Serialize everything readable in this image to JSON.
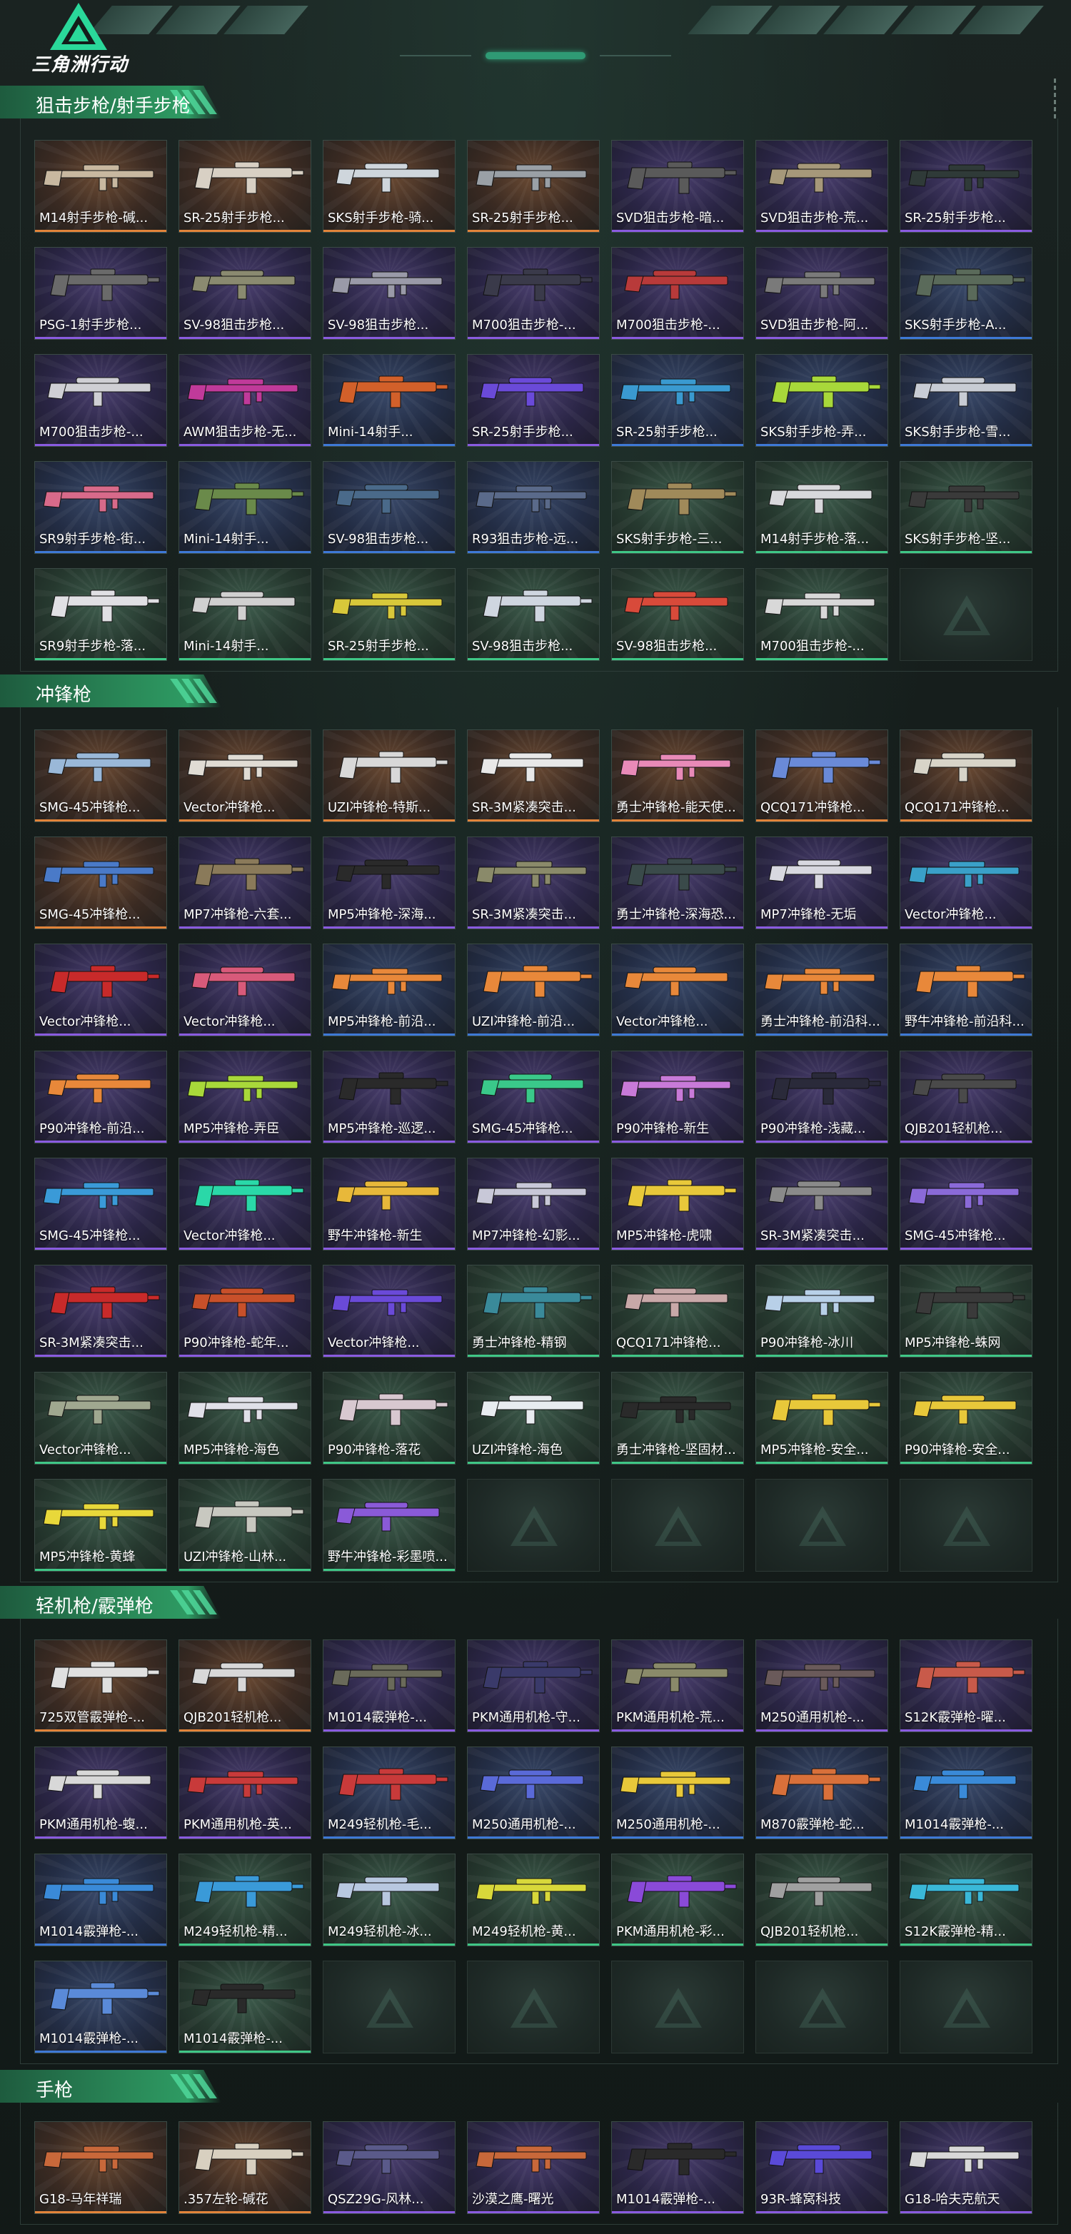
{
  "header": {
    "logo_text": "三角洲行动"
  },
  "colors": {
    "orange": "#e2843a",
    "purple": "#8a5be0",
    "blue": "#3e79d6",
    "green": "#3fc786",
    "section_green": "#2a8a59"
  },
  "sections": [
    {
      "title": "狙击步枪/射手步枪",
      "items": [
        {
          "name": "M14射手步枪-碱...",
          "rarity": "orange",
          "tint": "#c8b8a0"
        },
        {
          "name": "SR-25射手步枪...",
          "rarity": "orange",
          "tint": "#d8d0c4"
        },
        {
          "name": "SKS射手步枪-骑...",
          "rarity": "orange",
          "tint": "#cfd6dc"
        },
        {
          "name": "SR-25射手步枪...",
          "rarity": "orange",
          "tint": "#9aa0a6"
        },
        {
          "name": "SVD狙击步枪-暗...",
          "rarity": "purple",
          "tint": "#5a5a5a"
        },
        {
          "name": "SVD狙击步枪-荒...",
          "rarity": "purple",
          "tint": "#a6987a"
        },
        {
          "name": "SR-25射手步枪...",
          "rarity": "purple",
          "tint": "#2f3a38"
        },
        {
          "name": "PSG-1射手步枪...",
          "rarity": "purple",
          "tint": "#6a6a6a"
        },
        {
          "name": "SV-98狙击步枪...",
          "rarity": "purple",
          "tint": "#8a8a70"
        },
        {
          "name": "SV-98狙击步枪...",
          "rarity": "purple",
          "tint": "#9a9aa8"
        },
        {
          "name": "M700狙击步枪-...",
          "rarity": "purple",
          "tint": "#3a3a4a"
        },
        {
          "name": "M700狙击步枪-...",
          "rarity": "purple",
          "tint": "#b83a3a"
        },
        {
          "name": "SVD狙击步枪-阿...",
          "rarity": "purple",
          "tint": "#7a7a7a"
        },
        {
          "name": "SKS射手步枪-A...",
          "rarity": "blue",
          "tint": "#5a6a5a"
        },
        {
          "name": "M700狙击步枪-...",
          "rarity": "purple",
          "tint": "#cfcfd4"
        },
        {
          "name": "AWM狙击步枪-无...",
          "rarity": "purple",
          "tint": "#c03a9a"
        },
        {
          "name": "Mini-14射手...",
          "rarity": "blue",
          "tint": "#d2602a"
        },
        {
          "name": "SR-25射手步枪...",
          "rarity": "purple",
          "tint": "#6a4ad8"
        },
        {
          "name": "SR-25射手步枪...",
          "rarity": "blue",
          "tint": "#3a9ad0"
        },
        {
          "name": "SKS射手步枪-弄...",
          "rarity": "blue",
          "tint": "#a8d83a"
        },
        {
          "name": "SKS射手步枪-雪...",
          "rarity": "blue",
          "tint": "#c8ccd4"
        },
        {
          "name": "SR9射手步枪-街...",
          "rarity": "blue",
          "tint": "#d86a8a"
        },
        {
          "name": "Mini-14射手...",
          "rarity": "blue",
          "tint": "#6a8a4a"
        },
        {
          "name": "SV-98狙击步枪...",
          "rarity": "blue",
          "tint": "#4a6a8a"
        },
        {
          "name": "R93狙击步枪-远...",
          "rarity": "blue",
          "tint": "#5a6a8a"
        },
        {
          "name": "SKS射手步枪-三...",
          "rarity": "green",
          "tint": "#a08a5a"
        },
        {
          "name": "M14射手步枪-落...",
          "rarity": "green",
          "tint": "#d8d8dc"
        },
        {
          "name": "SKS射手步枪-坚...",
          "rarity": "green",
          "tint": "#3a3a3a"
        },
        {
          "name": "SR9射手步枪-落...",
          "rarity": "green",
          "tint": "#e0e0e4"
        },
        {
          "name": "Mini-14射手...",
          "rarity": "green",
          "tint": "#d0d0d0"
        },
        {
          "name": "SR-25射手步枪...",
          "rarity": "green",
          "tint": "#d8c83a"
        },
        {
          "name": "SV-98狙击步枪...",
          "rarity": "green",
          "tint": "#cfd6e0"
        },
        {
          "name": "SV-98狙击步枪...",
          "rarity": "green",
          "tint": "#d84a3a"
        },
        {
          "name": "M700狙击步枪-...",
          "rarity": "green",
          "tint": "#d8d8d8"
        },
        {
          "name": "",
          "rarity": "empty",
          "tint": ""
        }
      ]
    },
    {
      "title": "冲锋枪",
      "items": [
        {
          "name": "SMG-45冲锋枪...",
          "rarity": "orange",
          "tint": "#9ab8d8"
        },
        {
          "name": "Vector冲锋枪...",
          "rarity": "orange",
          "tint": "#e0dcd4"
        },
        {
          "name": "UZI冲锋枪-特斯...",
          "rarity": "orange",
          "tint": "#d8d8d8"
        },
        {
          "name": "SR-3M紧凑突击...",
          "rarity": "orange",
          "tint": "#e8e8e8"
        },
        {
          "name": "勇士冲锋枪-能天使...",
          "rarity": "orange",
          "tint": "#e88ab8"
        },
        {
          "name": "QCQ171冲锋枪...",
          "rarity": "orange",
          "tint": "#6a8ad8"
        },
        {
          "name": "QCQ171冲锋枪...",
          "rarity": "orange",
          "tint": "#d8d4c8"
        },
        {
          "name": "SMG-45冲锋枪...",
          "rarity": "orange",
          "tint": "#4a7ac8"
        },
        {
          "name": "MP7冲锋枪-六套...",
          "rarity": "purple",
          "tint": "#8a7a5a"
        },
        {
          "name": "MP5冲锋枪-深海...",
          "rarity": "purple",
          "tint": "#2a2a2a"
        },
        {
          "name": "SR-3M紧凑突击...",
          "rarity": "purple",
          "tint": "#8a8a6a"
        },
        {
          "name": "勇士冲锋枪-深海恐...",
          "rarity": "purple",
          "tint": "#3a4a4a"
        },
        {
          "name": "MP7冲锋枪-无垢",
          "rarity": "purple",
          "tint": "#d8d8e0"
        },
        {
          "name": "Vector冲锋枪...",
          "rarity": "purple",
          "tint": "#3aa0c8"
        },
        {
          "name": "Vector冲锋枪...",
          "rarity": "purple",
          "tint": "#c82a2a"
        },
        {
          "name": "Vector冲锋枪...",
          "rarity": "purple",
          "tint": "#d85a7a"
        },
        {
          "name": "MP5冲锋枪-前沿...",
          "rarity": "blue",
          "tint": "#e8883a"
        },
        {
          "name": "UZI冲锋枪-前沿...",
          "rarity": "blue",
          "tint": "#e8883a"
        },
        {
          "name": "Vector冲锋枪...",
          "rarity": "blue",
          "tint": "#e8883a"
        },
        {
          "name": "勇士冲锋枪-前沿科...",
          "rarity": "blue",
          "tint": "#e8883a"
        },
        {
          "name": "野牛冲锋枪-前沿科...",
          "rarity": "blue",
          "tint": "#e8883a"
        },
        {
          "name": "P90冲锋枪-前沿...",
          "rarity": "purple",
          "tint": "#e8883a"
        },
        {
          "name": "MP5冲锋枪-弄臣",
          "rarity": "purple",
          "tint": "#a8d83a"
        },
        {
          "name": "MP5冲锋枪-巡逻...",
          "rarity": "purple",
          "tint": "#2a2a2a"
        },
        {
          "name": "SMG-45冲锋枪...",
          "rarity": "purple",
          "tint": "#3ac88a"
        },
        {
          "name": "P90冲锋枪-新生",
          "rarity": "purple",
          "tint": "#c87ad8"
        },
        {
          "name": "P90冲锋枪-浅藏...",
          "rarity": "purple",
          "tint": "#2a2a3a"
        },
        {
          "name": "QJB201轻机枪...",
          "rarity": "purple",
          "tint": "#4a4a4a"
        },
        {
          "name": "SMG-45冲锋枪...",
          "rarity": "purple",
          "tint": "#3a9ad8"
        },
        {
          "name": "Vector冲锋枪...",
          "rarity": "purple",
          "tint": "#2ad8a8"
        },
        {
          "name": "野牛冲锋枪-新生",
          "rarity": "purple",
          "tint": "#e8b83a"
        },
        {
          "name": "MP7冲锋枪-幻影...",
          "rarity": "purple",
          "tint": "#c8c8d8"
        },
        {
          "name": "MP5冲锋枪-虎啸",
          "rarity": "purple",
          "tint": "#e8c83a"
        },
        {
          "name": "SR-3M紧凑突击...",
          "rarity": "purple",
          "tint": "#8a8a8a"
        },
        {
          "name": "SMG-45冲锋枪...",
          "rarity": "purple",
          "tint": "#8a6ad8"
        },
        {
          "name": "SR-3M紧凑突击...",
          "rarity": "purple",
          "tint": "#c82a2a"
        },
        {
          "name": "P90冲锋枪-蛇年...",
          "rarity": "purple",
          "tint": "#c8502a"
        },
        {
          "name": "Vector冲锋枪...",
          "rarity": "purple",
          "tint": "#6a4ad8"
        },
        {
          "name": "勇士冲锋枪-精钢",
          "rarity": "green",
          "tint": "#3a8a9a"
        },
        {
          "name": "QCQ171冲锋枪...",
          "rarity": "green",
          "tint": "#c8a8a8"
        },
        {
          "name": "P90冲锋枪-冰川",
          "rarity": "green",
          "tint": "#b8d0e8"
        },
        {
          "name": "MP5冲锋枪-蛛网",
          "rarity": "green",
          "tint": "#3a3a3a"
        },
        {
          "name": "Vector冲锋枪...",
          "rarity": "green",
          "tint": "#a0a890"
        },
        {
          "name": "MP5冲锋枪-海色",
          "rarity": "green",
          "tint": "#e0e0e8"
        },
        {
          "name": "P90冲锋枪-落花",
          "rarity": "green",
          "tint": "#d8c8d0"
        },
        {
          "name": "UZI冲锋枪-海色",
          "rarity": "green",
          "tint": "#e8ecf0"
        },
        {
          "name": "勇士冲锋枪-坚固材...",
          "rarity": "green",
          "tint": "#2a2a2a"
        },
        {
          "name": "MP5冲锋枪-安全...",
          "rarity": "green",
          "tint": "#e8c83a"
        },
        {
          "name": "P90冲锋枪-安全...",
          "rarity": "green",
          "tint": "#e8c83a"
        },
        {
          "name": "MP5冲锋枪-黄蜂",
          "rarity": "green",
          "tint": "#e8d83a"
        },
        {
          "name": "UZI冲锋枪-山林...",
          "rarity": "green",
          "tint": "#c8c8c0"
        },
        {
          "name": "野牛冲锋枪-彩墨喷...",
          "rarity": "green",
          "tint": "#8a5ad8"
        },
        {
          "name": "",
          "rarity": "empty",
          "tint": ""
        },
        {
          "name": "",
          "rarity": "empty",
          "tint": ""
        },
        {
          "name": "",
          "rarity": "empty",
          "tint": ""
        },
        {
          "name": "",
          "rarity": "empty",
          "tint": ""
        }
      ]
    },
    {
      "title": "轻机枪/霰弹枪",
      "items": [
        {
          "name": "725双管霰弹枪-...",
          "rarity": "orange",
          "tint": "#e0e0e0"
        },
        {
          "name": "QJB201轻机枪...",
          "rarity": "orange",
          "tint": "#d8d8d8"
        },
        {
          "name": "M1014霰弹枪-...",
          "rarity": "purple",
          "tint": "#6a6a5a"
        },
        {
          "name": "PKM通用机枪-守...",
          "rarity": "purple",
          "tint": "#3a3a6a"
        },
        {
          "name": "PKM通用机枪-荒...",
          "rarity": "purple",
          "tint": "#8a8a6a"
        },
        {
          "name": "M250通用机枪-...",
          "rarity": "purple",
          "tint": "#6a5a5a"
        },
        {
          "name": "S12K霰弹枪-曜...",
          "rarity": "purple",
          "tint": "#c85a4a"
        },
        {
          "name": "PKM通用机枪-蝮...",
          "rarity": "purple",
          "tint": "#d8d8d8"
        },
        {
          "name": "PKM通用机枪-英...",
          "rarity": "purple",
          "tint": "#c83a3a"
        },
        {
          "name": "M249轻机枪-毛...",
          "rarity": "blue",
          "tint": "#c83a3a"
        },
        {
          "name": "M250通用机枪-...",
          "rarity": "blue",
          "tint": "#5a6ad8"
        },
        {
          "name": "M250通用机枪-...",
          "rarity": "blue",
          "tint": "#e8c83a"
        },
        {
          "name": "M870霰弹枪-蛇...",
          "rarity": "blue",
          "tint": "#d8703a"
        },
        {
          "name": "M1014霰弹枪-...",
          "rarity": "blue",
          "tint": "#3a8ad8"
        },
        {
          "name": "M1014霰弹枪-...",
          "rarity": "blue",
          "tint": "#3a8ad8"
        },
        {
          "name": "M249轻机枪-精...",
          "rarity": "green",
          "tint": "#3a9ad8"
        },
        {
          "name": "M249轻机枪-冰...",
          "rarity": "green",
          "tint": "#b8c8e0"
        },
        {
          "name": "M249轻机枪-黄...",
          "rarity": "green",
          "tint": "#d8d83a"
        },
        {
          "name": "PKM通用机枪-彩...",
          "rarity": "green",
          "tint": "#8a4ad8"
        },
        {
          "name": "QJB201轻机枪...",
          "rarity": "green",
          "tint": "#a0a0a0"
        },
        {
          "name": "S12K霰弹枪-精...",
          "rarity": "green",
          "tint": "#3ab8d8"
        },
        {
          "name": "M1014霰弹枪-...",
          "rarity": "blue",
          "tint": "#5a8ad8"
        },
        {
          "name": "M1014霰弹枪-...",
          "rarity": "green",
          "tint": "#2a2a2a"
        },
        {
          "name": "",
          "rarity": "empty",
          "tint": ""
        },
        {
          "name": "",
          "rarity": "empty",
          "tint": ""
        },
        {
          "name": "",
          "rarity": "empty",
          "tint": ""
        },
        {
          "name": "",
          "rarity": "empty",
          "tint": ""
        },
        {
          "name": "",
          "rarity": "empty",
          "tint": ""
        }
      ]
    },
    {
      "title": "手枪",
      "items": [
        {
          "name": "G18-马年祥瑞",
          "rarity": "orange",
          "tint": "#c8683a"
        },
        {
          "name": ".357左轮-碱花",
          "rarity": "orange",
          "tint": "#d8d0c0"
        },
        {
          "name": "QSZ29G-风林...",
          "rarity": "purple",
          "tint": "#5a5a8a"
        },
        {
          "name": "沙漠之鹰-曙光",
          "rarity": "purple",
          "tint": "#c8683a"
        },
        {
          "name": "M1014霰弹枪-...",
          "rarity": "purple",
          "tint": "#2a2a2a"
        },
        {
          "name": "93R-蜂窝科技",
          "rarity": "purple",
          "tint": "#5a4ad8"
        },
        {
          "name": "G18-哈夫克航天",
          "rarity": "purple",
          "tint": "#d8d8d8"
        }
      ]
    }
  ]
}
